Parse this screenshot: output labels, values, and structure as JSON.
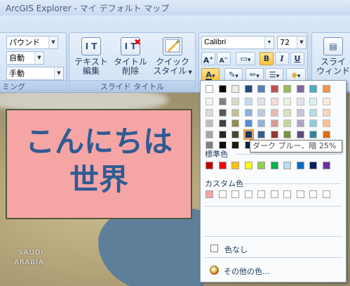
{
  "window": {
    "title": "ArcGIS Explorer - マイ デフォルト マップ"
  },
  "ribbon": {
    "left_group": {
      "combo1": "パウンド",
      "combo2": "自動",
      "combo3": "手動",
      "label": "ミング"
    },
    "slide_title_group": {
      "label": "スライド タイトル",
      "edit_text": [
        "テキスト",
        "編集"
      ],
      "delete_title": [
        "タイトル",
        "削除"
      ],
      "quick_style": [
        "クイック",
        "スタイル"
      ]
    },
    "font_group": {
      "font_name": "Calibri",
      "font_size": "72",
      "bold": "B",
      "italic": "I",
      "underline": "U",
      "grow": "A",
      "shrink": "A",
      "font_color": "A"
    },
    "right_group": {
      "label": [
        "スライ",
        "ウィンド"
      ]
    }
  },
  "map": {
    "labels": [
      "SAUDI",
      "ARABIA"
    ]
  },
  "slide": {
    "line1": "こんにちは",
    "line2": "世界"
  },
  "color_picker": {
    "theme_top": [
      "#ffffff",
      "#000000",
      "#eeece1",
      "#1f497d",
      "#4f81bd",
      "#c0504d",
      "#9bbb59",
      "#8064a2",
      "#4bacc6",
      "#f79646"
    ],
    "theme_columns": [
      [
        "#f2f2f2",
        "#d9d9d9",
        "#bfbfbf",
        "#a6a6a6",
        "#808080"
      ],
      [
        "#7f7f7f",
        "#595959",
        "#404040",
        "#262626",
        "#0d0d0d"
      ],
      [
        "#ddd9c3",
        "#c4bd97",
        "#948a54",
        "#4a452a",
        "#1d1b10"
      ],
      [
        "#c6d9f0",
        "#8db3e2",
        "#548dd4",
        "#17365d",
        "#0f243e"
      ],
      [
        "#dbe5f1",
        "#b8cce4",
        "#95b3d7",
        "#366092",
        "#244061"
      ],
      [
        "#f2dcdb",
        "#e5b9b7",
        "#d99694",
        "#953734",
        "#632423"
      ],
      [
        "#ebf1dd",
        "#d7e3bc",
        "#c3d69b",
        "#76923c",
        "#4f6128"
      ],
      [
        "#e5e0ec",
        "#ccc1d9",
        "#b2a2c7",
        "#5f497a",
        "#3f3151"
      ],
      [
        "#dbeef3",
        "#b7dde8",
        "#92cddc",
        "#31859b",
        "#205867"
      ],
      [
        "#fdeada",
        "#fbd5b5",
        "#fac08f",
        "#e36c09",
        "#974806"
      ]
    ],
    "standard_label": "標準色",
    "standard": [
      "#c00000",
      "#ff0000",
      "#ffc000",
      "#ffff00",
      "#92d050",
      "#00b050",
      "#b7dde8",
      "#0070c0",
      "#002060",
      "#7030a0"
    ],
    "custom_label": "カスタム色",
    "custom": [
      "#f6a5a5",
      "#ffffff",
      "#ffffff",
      "#ffffff",
      "#ffffff",
      "#ffffff",
      "#ffffff",
      "#ffffff",
      "#ffffff",
      "#ffffff"
    ],
    "no_color": "色なし",
    "more_colors": "その他の色...",
    "tooltip": "ダーク ブルー、暗 25%"
  }
}
